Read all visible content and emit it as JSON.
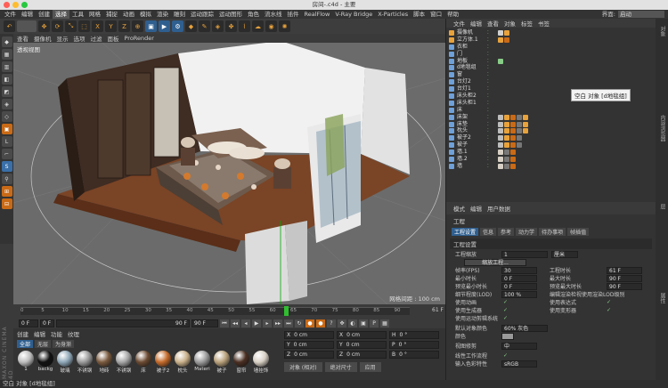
{
  "window": {
    "title": "房间-.c4d - 主要"
  },
  "menubar": {
    "items": [
      "文件",
      "编辑",
      "创建",
      "选择",
      "工具",
      "网格",
      "捕捉",
      "动画",
      "模拟",
      "渲染",
      "雕刻",
      "运动跟踪",
      "运动图形",
      "角色",
      "流水线",
      "插件",
      "RealFlow",
      "V-Ray Bridge",
      "X-Particles",
      "脚本",
      "窗口",
      "帮助"
    ],
    "selected_index": 3
  },
  "layout": {
    "label": "界面:",
    "value": "启动"
  },
  "toolbar": {
    "icons": [
      "undo-icon",
      "move-icon",
      "rotate-icon",
      "scale-icon",
      "select-icon",
      "x-axis-icon",
      "y-axis-icon",
      "z-axis-icon",
      "coord-icon",
      "render-view-icon",
      "render-icon",
      "render-settings-icon",
      "cube-icon",
      "pen-icon",
      "subdiv-icon",
      "array-icon",
      "deformer-icon",
      "scene-icon",
      "camera-icon",
      "light-icon"
    ],
    "axis": [
      "X",
      "Y",
      "Z"
    ]
  },
  "viewport": {
    "menu": [
      "查看",
      "摄像机",
      "显示",
      "选项",
      "过滤",
      "面板",
      "ProRender"
    ],
    "label": "透视视图",
    "grid_info": "网格间距 : 100 cm"
  },
  "timeline": {
    "ticks": [
      "0",
      "5",
      "10",
      "15",
      "20",
      "25",
      "30",
      "35",
      "40",
      "45",
      "50",
      "55",
      "60",
      "65",
      "70",
      "75",
      "80",
      "85",
      "90"
    ],
    "current": "61 F",
    "start": "0 F",
    "start2": "0 F",
    "end": "90 F",
    "end2": "90 F"
  },
  "material_manager": {
    "menu": [
      "创建",
      "编辑",
      "功能",
      "纹理"
    ],
    "tabs": [
      "全部",
      "无层",
      "为身渐"
    ],
    "materials": [
      {
        "name": "1",
        "color": "#bdbdbd"
      },
      {
        "name": "backg",
        "color": "#111111"
      },
      {
        "name": "玻璃",
        "color": "#8fa7b8"
      },
      {
        "name": "不锈钢",
        "color": "#9a9a9a"
      },
      {
        "name": "地砖",
        "color": "#7a5a3e"
      },
      {
        "name": "不锈钢",
        "color": "#a5a5a5"
      },
      {
        "name": "床",
        "color": "#6b4a32"
      },
      {
        "name": "被子2",
        "color": "#c46a2a"
      },
      {
        "name": "枕头",
        "color": "#c9b08a"
      },
      {
        "name": "Materi",
        "color": "#9b9b9b"
      },
      {
        "name": "被子",
        "color": "#b8a07a"
      },
      {
        "name": "窗帘",
        "color": "#4a2f22"
      },
      {
        "name": "墙挂饰",
        "color": "#d7cfc4"
      }
    ]
  },
  "coordinates": {
    "rows": [
      {
        "axis": "X",
        "pos": "0 cm",
        "axis2": "X",
        "size": "0 cm",
        "rot_label": "H",
        "rot": "0 °"
      },
      {
        "axis": "Y",
        "pos": "0 cm",
        "axis2": "Y",
        "size": "0 cm",
        "rot_label": "P",
        "rot": "0 °"
      },
      {
        "axis": "Z",
        "pos": "0 cm",
        "axis2": "Z",
        "size": "0 cm",
        "rot_label": "B",
        "rot": "0 °"
      }
    ],
    "mode": "对象 (相对)",
    "size_mode": "绝对尺寸",
    "apply": "应用"
  },
  "object_manager": {
    "menu": [
      "文件",
      "编辑",
      "查看",
      "对象",
      "标签",
      "书签"
    ],
    "objects": [
      {
        "name": "摄像机",
        "tags": [
          "#d0d0d0",
          "#e8a23c"
        ]
      },
      {
        "name": "立方体.1",
        "tags": [
          "#e8a23c",
          "#c96a16"
        ]
      },
      {
        "name": "衣柜",
        "tags": []
      },
      {
        "name": "门",
        "tags": []
      },
      {
        "name": "地板",
        "tags": [
          "#8c8"
        ]
      },
      {
        "name": "d地毯组",
        "tags": []
      },
      {
        "name": "窗",
        "tags": []
      },
      {
        "name": "台灯2",
        "tags": []
      },
      {
        "name": "台灯1",
        "tags": []
      },
      {
        "name": "床头柜2",
        "tags": []
      },
      {
        "name": "床头柜1",
        "tags": []
      },
      {
        "name": "床",
        "tags": []
      },
      {
        "name": "床架",
        "tags": [
          "#bdbdbd",
          "#e8a23c",
          "#c96a16",
          "#777",
          "#e8a23c"
        ]
      },
      {
        "name": "床垫",
        "tags": [
          "#bdbdbd",
          "#e8a23c",
          "#c96a16",
          "#777",
          "#e8a23c"
        ]
      },
      {
        "name": "枕头",
        "tags": [
          "#bdbdbd",
          "#e8a23c",
          "#c96a16",
          "#777",
          "#e8a23c"
        ]
      },
      {
        "name": "被子2",
        "tags": [
          "#bdbdbd",
          "#e8a23c",
          "#c96a16",
          "#777"
        ]
      },
      {
        "name": "被子",
        "tags": [
          "#bdbdbd",
          "#e8a23c",
          "#c96a16",
          "#777"
        ]
      },
      {
        "name": "墙.1",
        "tags": [
          "#d7cfc4",
          "#777",
          "#c96a16"
        ]
      },
      {
        "name": "墙.2",
        "tags": [
          "#d7cfc4",
          "#777",
          "#c96a16"
        ]
      },
      {
        "name": "墙",
        "tags": [
          "#d7cfc4",
          "#777",
          "#c96a16"
        ]
      }
    ],
    "tooltip": "空白 对象 [d地毯组]"
  },
  "attribute_manager": {
    "menu": [
      "模式",
      "编辑",
      "用户数据"
    ],
    "title": "工程",
    "tabs": [
      "工程设置",
      "信息",
      "参考",
      "动力学",
      "待办事项",
      "帧插值"
    ],
    "section": "工程设置",
    "fields": {
      "scale_label": "工程缩放",
      "scale_value": "1",
      "scale_unit": "厘米",
      "scale_btn": "缩放工程...",
      "fps_label": "帧率(FPS)",
      "fps": "30",
      "proj_len_label": "工程时长",
      "proj_len": "61 F",
      "min_label": "最小时长",
      "min": "0 F",
      "max_label": "最大时长",
      "max": "90 F",
      "pmin_label": "预览最小时长",
      "pmin": "0 F",
      "pmax_label": "预览最大时长",
      "pmax": "90 F",
      "lod_label": "细节程度(LOD)",
      "lod": "100 %",
      "lod_render_label": "编辑渲染检视使用渲染LOD级别",
      "anim_label": "使用动画",
      "expr_label": "使用表达式",
      "gen_label": "使用生成器",
      "def_label": "使用变形器",
      "motion_label": "使用运动剪辑系统",
      "objcolor_label": "默认对象颜色",
      "objcolor": "60% 灰色",
      "color_label": "颜色",
      "view_clip_label": "视图修剪",
      "view_clip": "中",
      "linear_label": "线性工作流程",
      "input_color_label": "输入色彩特性",
      "input_color": "sRGB"
    }
  },
  "status": {
    "text": "空白 对象 [d地毯组]"
  },
  "side_labels": [
    "对象",
    "内容浏览器",
    "层",
    "属性"
  ],
  "maxon": "MAXON CINEMA 4D"
}
